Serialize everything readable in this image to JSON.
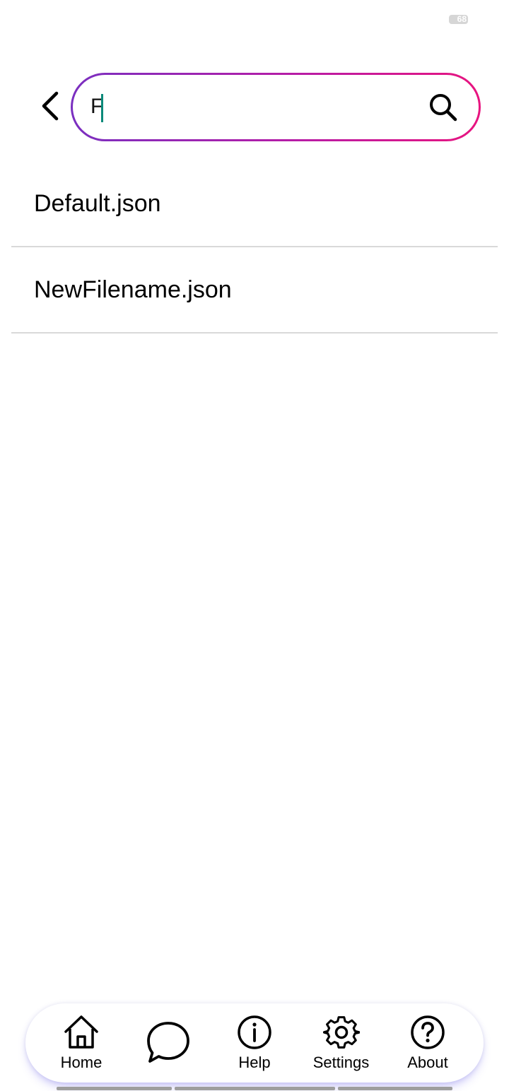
{
  "status_bar": {
    "battery_level": "68"
  },
  "header": {
    "back_icon": "chevron-left-icon",
    "search": {
      "value": "F",
      "placeholder": "",
      "icon": "search-icon",
      "border_gradient": [
        "#7a2fc0",
        "#e8147f"
      ],
      "caret_color": "#0a8a7a"
    }
  },
  "files": [
    {
      "name": "Default.json"
    },
    {
      "name": "NewFilename.json"
    }
  ],
  "bottom_nav": {
    "items": [
      {
        "label": "Home",
        "icon": "home-icon"
      },
      {
        "label": "",
        "icon": "chat-bubble-icon"
      },
      {
        "label": "Help",
        "icon": "info-icon"
      },
      {
        "label": "Settings",
        "icon": "gear-icon"
      },
      {
        "label": "About",
        "icon": "question-icon"
      }
    ],
    "shadow_color": "#786ef0"
  }
}
